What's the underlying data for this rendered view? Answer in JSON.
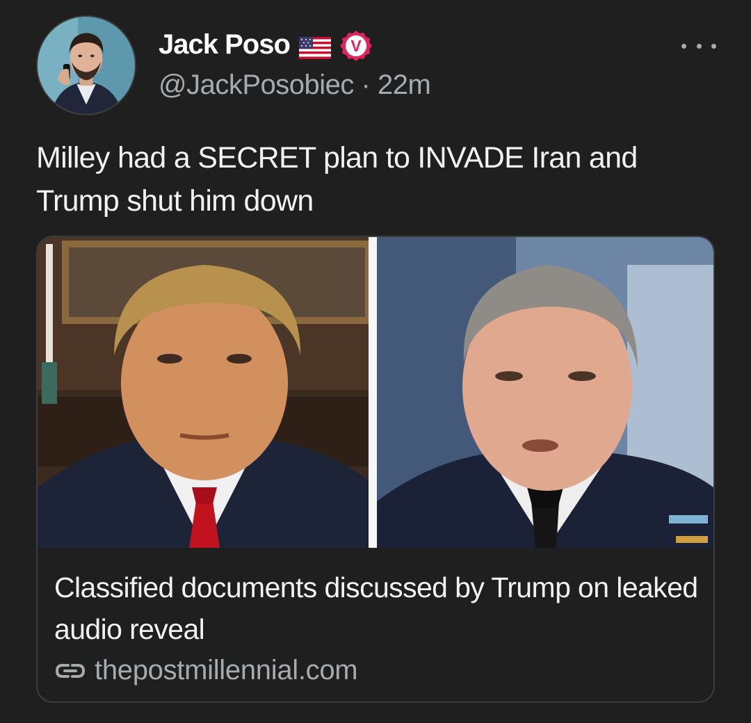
{
  "author": {
    "name": "Jack Poso",
    "flag_icon": "us-flag-icon",
    "verified_icon": "verified-badge-icon",
    "verified_letter": "V",
    "verified_color": "#e0245e",
    "handle": "@JackPosobiec",
    "separator": " · ",
    "time": "22m"
  },
  "menu": {
    "icon": "more-options-icon"
  },
  "tweet": {
    "text": "Milley had a SECRET plan to INVADE Iran and Trump shut him down"
  },
  "card": {
    "title": "Classified documents discussed by Trump on leaked audio reveal",
    "domain": "thepostmillennial.com",
    "link_icon": "link-icon"
  },
  "colors": {
    "background": "#1f1f20",
    "primary_text": "#f2f2f2",
    "secondary_text": "#a8abae",
    "card_border": "#3c3c3e"
  }
}
